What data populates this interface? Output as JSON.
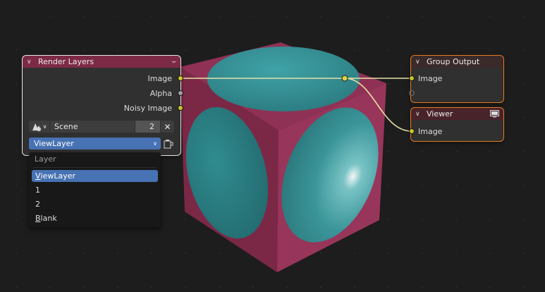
{
  "render_layers_node": {
    "title": "Render Layers",
    "outputs": [
      "Image",
      "Alpha",
      "Noisy Image"
    ],
    "scene_value": "Scene",
    "scene_users": "2",
    "layer_value": "ViewLayer"
  },
  "layer_menu": {
    "title": "Layer",
    "items": [
      {
        "first": "V",
        "rest": "iewLayer"
      },
      {
        "first": "",
        "rest": "1"
      },
      {
        "first": "",
        "rest": "2"
      },
      {
        "first": "B",
        "rest": "lank"
      }
    ]
  },
  "group_output_node": {
    "title": "Group Output",
    "inputs": [
      "Image"
    ]
  },
  "viewer_node": {
    "title": "Viewer",
    "inputs": [
      "Image"
    ]
  },
  "colors": {
    "background": "#1d1d1d",
    "socket_color": "#c7c729",
    "link_color": "#e8e2a6",
    "render_layers_header": "#7d2a46",
    "selection_orange": "#e77a1f",
    "menu_highlight": "#4772b3",
    "cube_face": "#8a2f52",
    "sphere": "#3a8f94"
  }
}
